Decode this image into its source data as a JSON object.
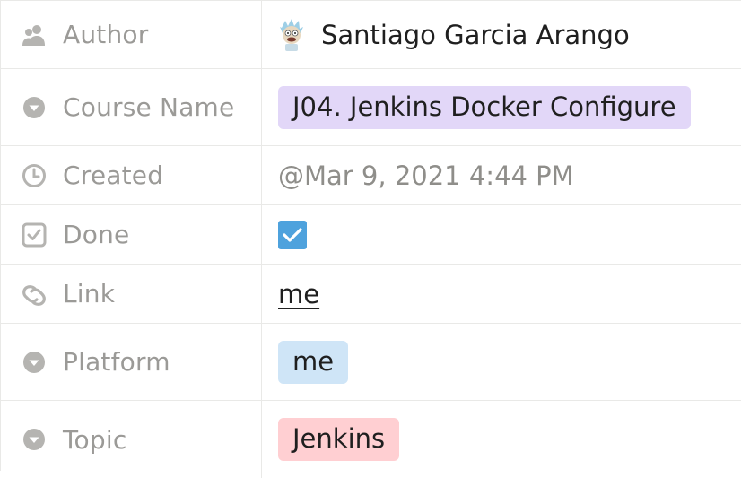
{
  "properties": [
    {
      "label": "Author",
      "value": "Santiago Garcia Arango"
    },
    {
      "label": "Course Name",
      "value": "J04. Jenkins Docker Configure"
    },
    {
      "label": "Created",
      "value": "@Mar 9, 2021 4:44 PM"
    },
    {
      "label": "Done",
      "value": "checked"
    },
    {
      "label": "Link",
      "value": "me"
    },
    {
      "label": "Platform",
      "value": "me"
    },
    {
      "label": "Topic",
      "value": "Jenkins"
    }
  ],
  "icons": {
    "author": "person-icon",
    "course_name": "select-icon",
    "created": "clock-icon",
    "done": "checkbox-icon",
    "link": "link-icon",
    "platform": "select-icon",
    "topic": "select-icon"
  },
  "colors": {
    "tag_purple": "#e2d7f8",
    "tag_blue": "#cfe5f7",
    "tag_red": "#ffcfd2",
    "checkbox_blue": "#4ea2dd"
  }
}
